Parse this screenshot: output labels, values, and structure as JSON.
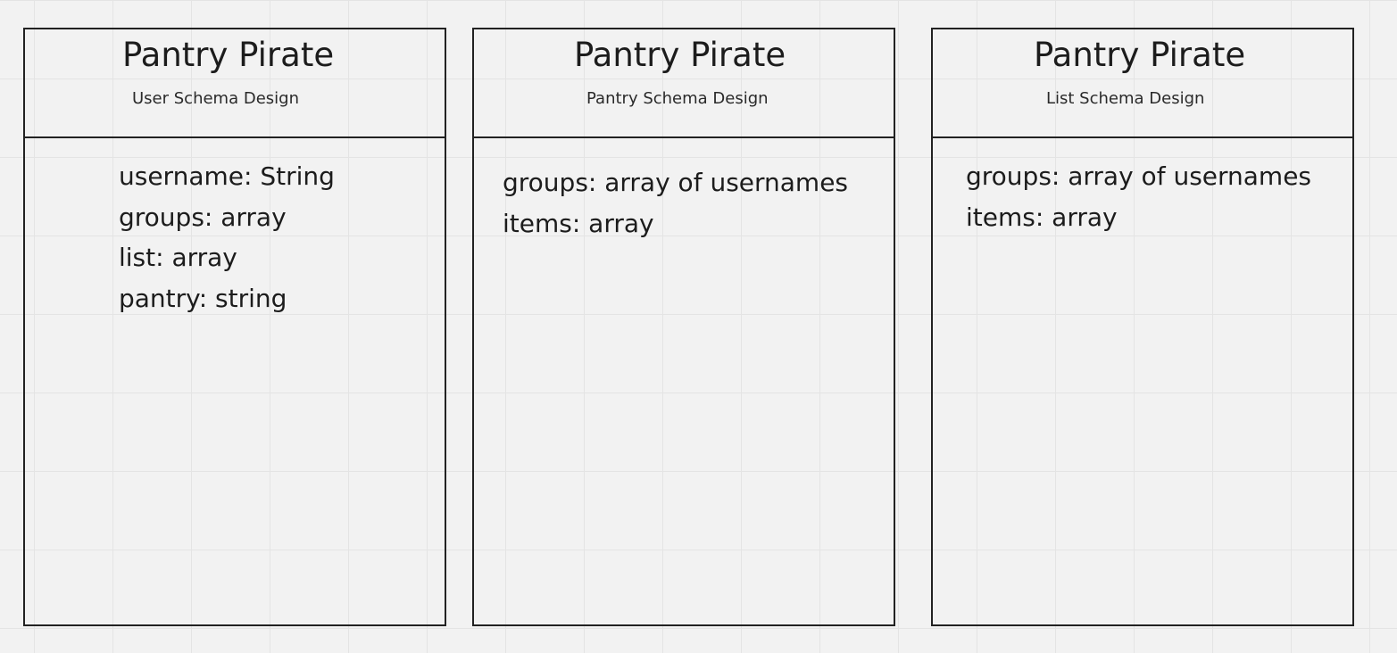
{
  "cards": [
    {
      "title": "Pantry Pirate",
      "subtitle": "User Schema Design",
      "fields": [
        "username: String",
        "groups: array",
        "list: array",
        "pantry: string"
      ]
    },
    {
      "title": "Pantry Pirate",
      "subtitle": "Pantry Schema Design",
      "fields": [
        "groups: array of usernames",
        "items: array"
      ]
    },
    {
      "title": "Pantry Pirate",
      "subtitle": "List Schema Design",
      "fields": [
        "groups: array of usernames",
        "items: array"
      ]
    }
  ],
  "colors": {
    "canvas_background": "#f2f2f2",
    "grid_line": "#e4e4e4",
    "border": "#222222",
    "text": "#1c1c1c"
  }
}
